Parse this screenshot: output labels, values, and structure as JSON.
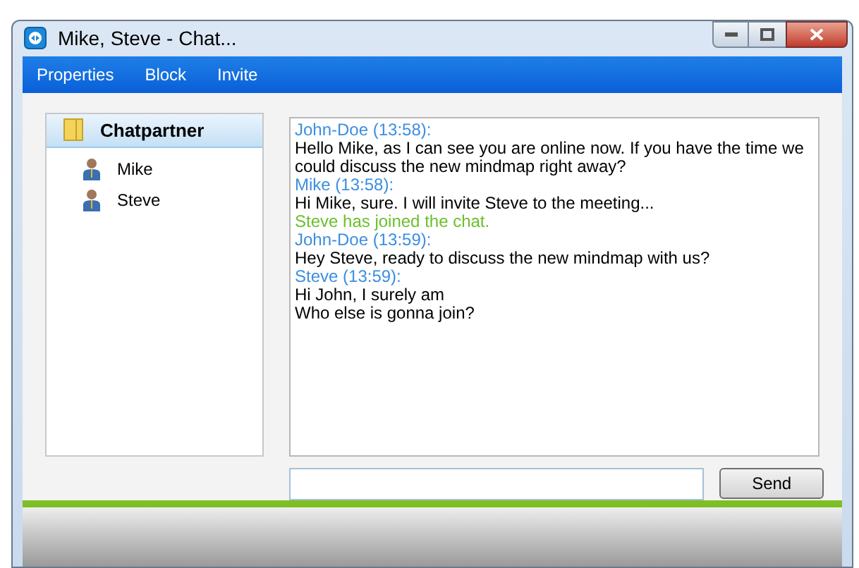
{
  "window": {
    "title": "Mike, Steve - Chat..."
  },
  "menu": [
    "Properties",
    "Block",
    "Invite"
  ],
  "sidebar": {
    "header": {
      "label": "Chatpartner",
      "selected": true
    },
    "items": [
      {
        "label": "Mike"
      },
      {
        "label": "Steve"
      }
    ]
  },
  "messages": [
    {
      "kind": "author",
      "text": "John-Doe (13:58):"
    },
    {
      "kind": "text",
      "text": "Hello Mike, as I can see you are online now. If you have the time we could discuss the new mindmap right away?"
    },
    {
      "kind": "author",
      "text": "Mike (13:58):"
    },
    {
      "kind": "text",
      "text": "Hi Mike, sure. I will invite Steve to the meeting..."
    },
    {
      "kind": "system",
      "text": "Steve has joined the chat."
    },
    {
      "kind": "author",
      "text": "John-Doe (13:59):"
    },
    {
      "kind": "text",
      "text": "Hey Steve, ready to discuss the new mindmap with us?"
    },
    {
      "kind": "author",
      "text": "Steve (13:59):"
    },
    {
      "kind": "text",
      "text": "Hi John, I surely am"
    },
    {
      "kind": "text",
      "text": "Who else is gonna join?"
    }
  ],
  "send_button": "Send"
}
